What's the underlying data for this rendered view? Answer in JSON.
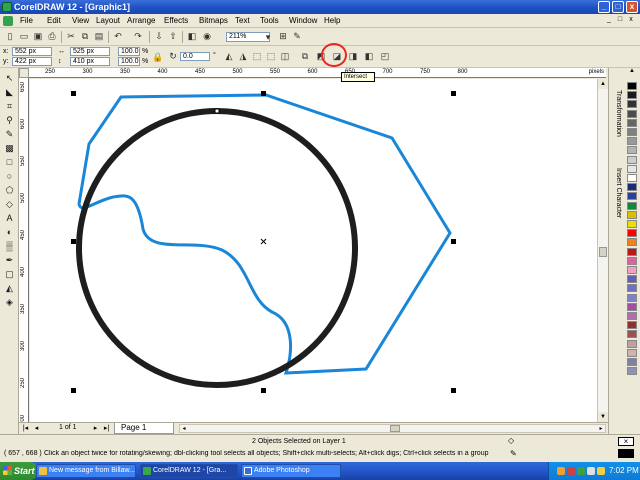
{
  "window": {
    "title": "CorelDRAW 12 - [Graphic1]",
    "minimize": "_",
    "maximize": "□",
    "close": "x",
    "doc_minimize": "_",
    "doc_restore": "□",
    "doc_close": "x"
  },
  "menu": [
    "File",
    "Edit",
    "View",
    "Layout",
    "Arrange",
    "Effects",
    "Bitmaps",
    "Text",
    "Tools",
    "Window",
    "Help"
  ],
  "standard_toolbar": {
    "zoom": "211%"
  },
  "property_bar": {
    "x": "552 px",
    "y": "422 px",
    "width": "525 px",
    "height": "410 px",
    "scale_x": "100.0",
    "scale_y": "100.0",
    "percent": "%",
    "rotation": "0.0",
    "tooltip": "Intersect",
    "highlight_color": "#e8261f"
  },
  "ruler_h": {
    "labels": [
      "250",
      "300",
      "350",
      "400",
      "450",
      "500",
      "550",
      "600",
      "650",
      "700",
      "750",
      "800"
    ],
    "unit": "pixels"
  },
  "ruler_v": {
    "labels": [
      "650",
      "600",
      "550",
      "500",
      "450",
      "400",
      "350",
      "300",
      "250",
      "200"
    ],
    "unit": "pixels"
  },
  "drawing": {
    "circle_color": "#1e1e1e",
    "polygon_color": "#1a86d8"
  },
  "dockers": [
    "Transformation",
    "Insert Character"
  ],
  "palette": [
    "#000000",
    "#1a1a1a",
    "#333333",
    "#4d4d4d",
    "#666666",
    "#808080",
    "#999999",
    "#b3b3b3",
    "#cccccc",
    "#e6e6e6",
    "#ffffff",
    "#1c2c7a",
    "#2a3f9e",
    "#0b8a3e",
    "#d9c100",
    "#e8e000",
    "#ff0000",
    "#f08020",
    "#c01818",
    "#e060a0",
    "#f0a0c0",
    "#6060b0",
    "#7070c0",
    "#8080d0",
    "#a050a0",
    "#b070b0",
    "#903030",
    "#a05050",
    "#c0a0a0",
    "#d0b0b0",
    "#8080a0",
    "#9090b0"
  ],
  "page_tabs": {
    "counter": "1 of 1",
    "page": "Page 1"
  },
  "status": {
    "coords": "( 657 , 668 )",
    "selection": "2 Objects Selected on Layer 1",
    "hint": "Click an object twice for rotating/skewing; dbl-clicking tool selects all objects; Shift+click multi-selects; Alt+click digs; Ctrl+click selects in a group"
  },
  "taskbar": {
    "start": "Start",
    "tasks": [
      "New message from Billaw...",
      "CorelDRAW 12 - [Gra...",
      "Adobe Photoshop"
    ],
    "clock": "7:02 PM"
  }
}
